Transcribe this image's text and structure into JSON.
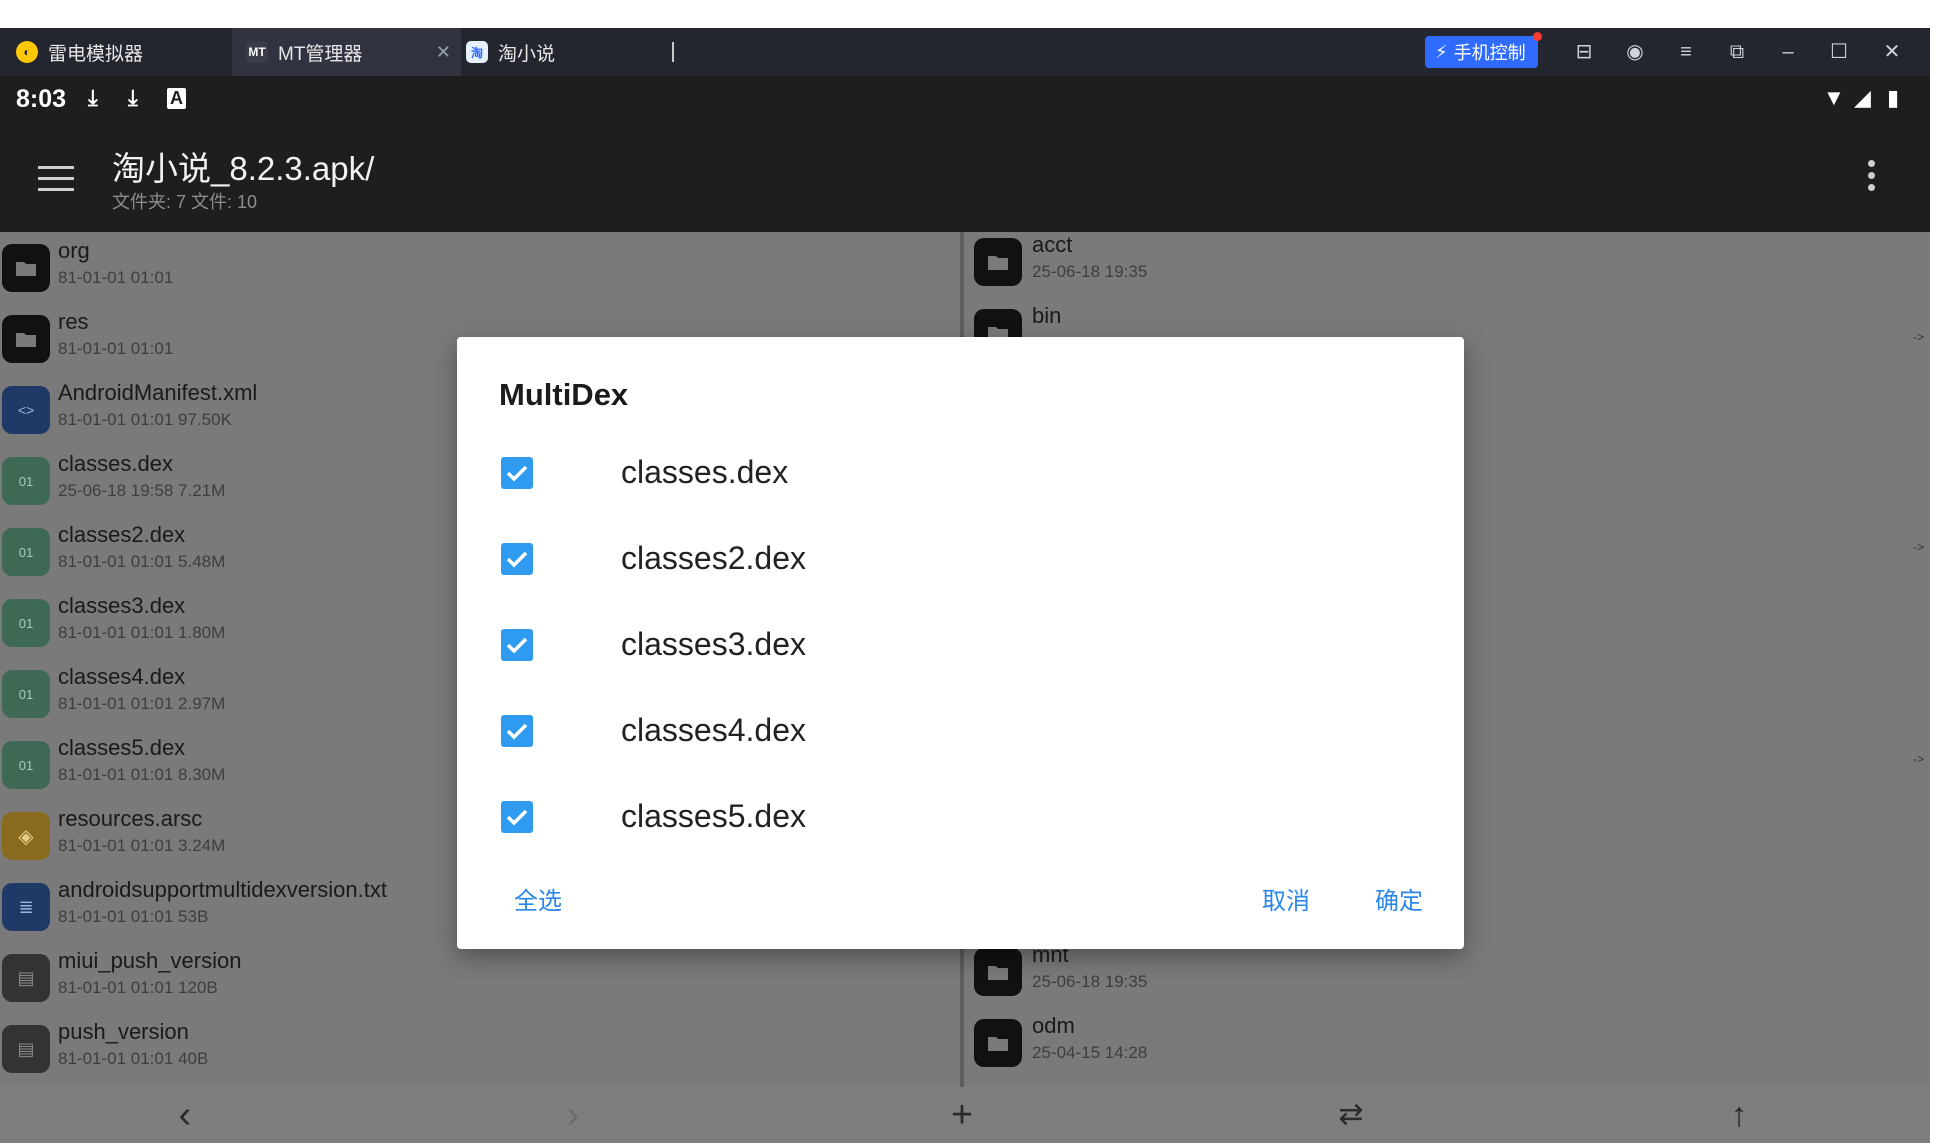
{
  "emulator": {
    "app_name": "雷电模拟器",
    "tabs": [
      {
        "label": "MT管理器"
      },
      {
        "label": "淘小说"
      }
    ],
    "phone_control_label": "手机控制"
  },
  "status_bar": {
    "time": "8:03"
  },
  "app_bar": {
    "title": "淘小说_8.2.3.apk/",
    "subtitle": "文件夹: 7  文件: 10"
  },
  "left_pane": {
    "items": [
      {
        "name": "org",
        "meta": "81-01-01 01:01",
        "kind": "folder"
      },
      {
        "name": "res",
        "meta": "81-01-01 01:01",
        "kind": "folder"
      },
      {
        "name": "AndroidManifest.xml",
        "meta": "81-01-01 01:01  97.50K",
        "kind": "xml"
      },
      {
        "name": "classes.dex",
        "meta": "25-06-18 19:58  7.21M",
        "kind": "dex"
      },
      {
        "name": "classes2.dex",
        "meta": "81-01-01 01:01  5.48M",
        "kind": "dex"
      },
      {
        "name": "classes3.dex",
        "meta": "81-01-01 01:01  1.80M",
        "kind": "dex"
      },
      {
        "name": "classes4.dex",
        "meta": "81-01-01 01:01  2.97M",
        "kind": "dex"
      },
      {
        "name": "classes5.dex",
        "meta": "81-01-01 01:01  8.30M",
        "kind": "dex"
      },
      {
        "name": "resources.arsc",
        "meta": "81-01-01 01:01  3.24M",
        "kind": "arsc"
      },
      {
        "name": "androidsupportmultidexversion.txt",
        "meta": "81-01-01 01:01  53B",
        "kind": "txt"
      },
      {
        "name": "miui_push_version",
        "meta": "81-01-01 01:01  120B",
        "kind": "file"
      },
      {
        "name": "push_version",
        "meta": "81-01-01 01:01  40B",
        "kind": "file"
      }
    ]
  },
  "right_pane": {
    "items": [
      {
        "name": "acct",
        "meta": "25-06-18 19:35"
      },
      {
        "name": "bin",
        "meta": ""
      },
      {
        "name": "mnt",
        "meta": "25-06-18 19:35"
      },
      {
        "name": "odm",
        "meta": "25-04-15 14:28"
      }
    ],
    "link_marker": "->"
  },
  "dialog": {
    "title": "MultiDex",
    "options": [
      {
        "label": "classes.dex",
        "checked": true
      },
      {
        "label": "classes2.dex",
        "checked": true
      },
      {
        "label": "classes3.dex",
        "checked": true
      },
      {
        "label": "classes4.dex",
        "checked": true
      },
      {
        "label": "classes5.dex",
        "checked": true
      }
    ],
    "select_all_label": "全选",
    "cancel_label": "取消",
    "confirm_label": "确定"
  },
  "bottom_bar": {
    "buttons": [
      "back-icon",
      "forward-icon",
      "add-icon",
      "swap-icon",
      "up-icon"
    ]
  },
  "colors": {
    "accent": "#2f9bf0",
    "dialog_button": "#2b87e8",
    "phone_control": "#2f6bff"
  }
}
